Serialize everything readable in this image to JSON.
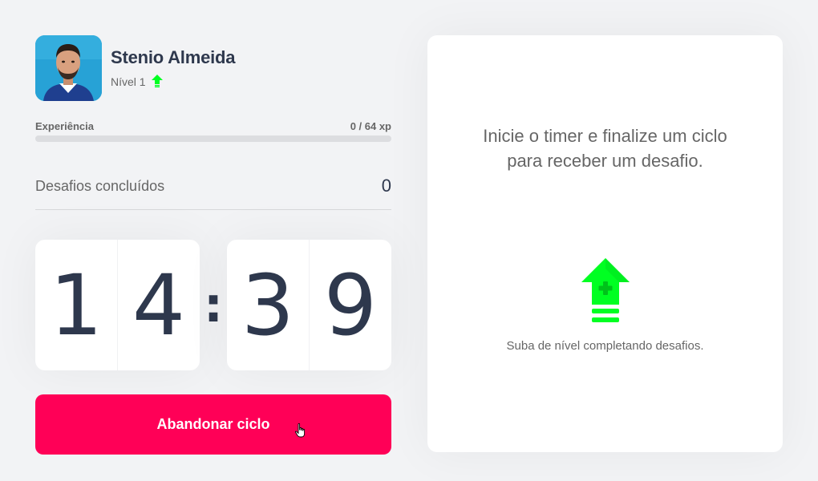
{
  "profile": {
    "name": "Stenio Almeida",
    "level_label": "Nível 1"
  },
  "experience": {
    "label": "Experiência",
    "current": 0,
    "total": 64,
    "text": "0 / 64 xp",
    "progress": 0
  },
  "challenges": {
    "label": "Desafios concluídos",
    "count": "0"
  },
  "timer": {
    "minute_tens": "1",
    "minute_ones": "4",
    "separator": ":",
    "second_tens": "3",
    "second_ones": "9"
  },
  "actions": {
    "abandon_label": "Abandonar ciclo"
  },
  "challenge_card": {
    "line1": "Inicie o timer e finalize um ciclo",
    "line2": "para receber um desafio.",
    "hint": "Suba de nível completando desafios."
  },
  "icons": {
    "level_up": "level-up-arrow-icon",
    "cursor": "hand-pointer-icon"
  },
  "colors": {
    "accent_red": "#ff0057",
    "level_green": "#00ff22",
    "text_dark": "#2e384d",
    "text": "#666666",
    "background": "#f2f3f5"
  }
}
